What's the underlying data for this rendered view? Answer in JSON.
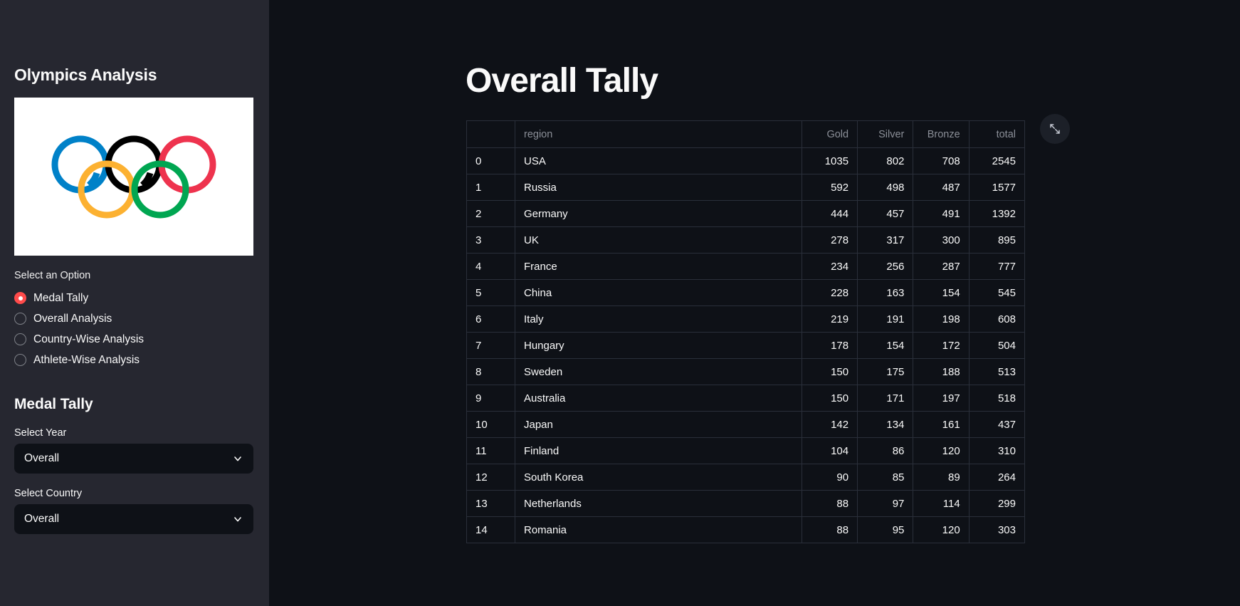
{
  "sidebar": {
    "title": "Olympics Analysis",
    "logo": {
      "name": "olympic-rings-logo",
      "ring_colors": [
        "#0081C8",
        "#000000",
        "#EE334E",
        "#FCB131",
        "#00A651"
      ]
    },
    "option_label": "Select an Option",
    "options": [
      {
        "label": "Medal Tally",
        "selected": true
      },
      {
        "label": "Overall Analysis",
        "selected": false
      },
      {
        "label": "Country-Wise Analysis",
        "selected": false
      },
      {
        "label": "Athlete-Wise Analysis",
        "selected": false
      }
    ],
    "section_heading": "Medal Tally",
    "year_label": "Select Year",
    "year_value": "Overall",
    "country_label": "Select Country",
    "country_value": "Overall"
  },
  "main": {
    "title": "Overall Tally",
    "expand_icon": "fullscreen-expand-icon"
  },
  "table": {
    "columns": [
      "",
      "region",
      "Gold",
      "Silver",
      "Bronze",
      "total"
    ],
    "rows": [
      {
        "idx": "0",
        "region": "USA",
        "gold": "1035",
        "silver": "802",
        "bronze": "708",
        "total": "2545"
      },
      {
        "idx": "1",
        "region": "Russia",
        "gold": "592",
        "silver": "498",
        "bronze": "487",
        "total": "1577"
      },
      {
        "idx": "2",
        "region": "Germany",
        "gold": "444",
        "silver": "457",
        "bronze": "491",
        "total": "1392"
      },
      {
        "idx": "3",
        "region": "UK",
        "gold": "278",
        "silver": "317",
        "bronze": "300",
        "total": "895"
      },
      {
        "idx": "4",
        "region": "France",
        "gold": "234",
        "silver": "256",
        "bronze": "287",
        "total": "777"
      },
      {
        "idx": "5",
        "region": "China",
        "gold": "228",
        "silver": "163",
        "bronze": "154",
        "total": "545"
      },
      {
        "idx": "6",
        "region": "Italy",
        "gold": "219",
        "silver": "191",
        "bronze": "198",
        "total": "608"
      },
      {
        "idx": "7",
        "region": "Hungary",
        "gold": "178",
        "silver": "154",
        "bronze": "172",
        "total": "504"
      },
      {
        "idx": "8",
        "region": "Sweden",
        "gold": "150",
        "silver": "175",
        "bronze": "188",
        "total": "513"
      },
      {
        "idx": "9",
        "region": "Australia",
        "gold": "150",
        "silver": "171",
        "bronze": "197",
        "total": "518"
      },
      {
        "idx": "10",
        "region": "Japan",
        "gold": "142",
        "silver": "134",
        "bronze": "161",
        "total": "437"
      },
      {
        "idx": "11",
        "region": "Finland",
        "gold": "104",
        "silver": "86",
        "bronze": "120",
        "total": "310"
      },
      {
        "idx": "12",
        "region": "South Korea",
        "gold": "90",
        "silver": "85",
        "bronze": "89",
        "total": "264"
      },
      {
        "idx": "13",
        "region": "Netherlands",
        "gold": "88",
        "silver": "97",
        "bronze": "114",
        "total": "299"
      },
      {
        "idx": "14",
        "region": "Romania",
        "gold": "88",
        "silver": "95",
        "bronze": "120",
        "total": "303"
      }
    ]
  },
  "theme": {
    "accent": "#ff4b4b",
    "sidebar_bg": "#262730",
    "main_bg": "#0e1117",
    "text": "#fafafa",
    "muted_text": "#8b8f98"
  }
}
